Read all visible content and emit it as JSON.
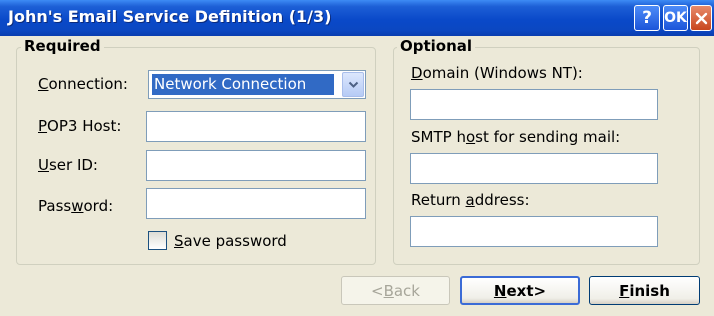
{
  "window": {
    "title": "John's Email Service Definition (1/3)",
    "help_glyph": "?",
    "ok_label": "OK"
  },
  "required": {
    "legend": "Required",
    "connection": {
      "label_pre": "",
      "label_key": "C",
      "label_post": "onnection:",
      "value": "Network Connection"
    },
    "pop3": {
      "label_pre": "",
      "label_key": "P",
      "label_post": "OP3 Host:",
      "value": ""
    },
    "userid": {
      "label_pre": "",
      "label_key": "U",
      "label_post": "ser ID:",
      "value": ""
    },
    "password": {
      "label_pre": "Pass",
      "label_key": "w",
      "label_post": "ord:",
      "value": ""
    },
    "save_password": {
      "label_pre": "",
      "label_key": "S",
      "label_post": "ave password",
      "checked": false
    }
  },
  "optional": {
    "legend": "Optional",
    "domain": {
      "label_pre": "",
      "label_key": "D",
      "label_post": "omain (Windows NT):",
      "value": ""
    },
    "smtp": {
      "label_pre": "SMTP h",
      "label_key": "o",
      "label_post": "st for sending mail:",
      "value": ""
    },
    "return": {
      "label_pre": "Return ",
      "label_key": "a",
      "label_post": "ddress:",
      "value": ""
    }
  },
  "buttons": {
    "back": {
      "pre": "<",
      "key": "B",
      "post": "ack",
      "enabled": false
    },
    "next": {
      "pre": "",
      "key": "N",
      "post": "ext>",
      "enabled": true
    },
    "finish": {
      "pre": "",
      "key": "F",
      "post": "inish",
      "enabled": true
    }
  },
  "colors": {
    "titlebar": "#0A49C9",
    "dialog_bg": "#ECE9D8",
    "selection": "#316AC5"
  },
  "icons": {
    "help": "question-mark-icon",
    "close": "close-x-icon",
    "dropdown": "chevron-down-icon"
  }
}
